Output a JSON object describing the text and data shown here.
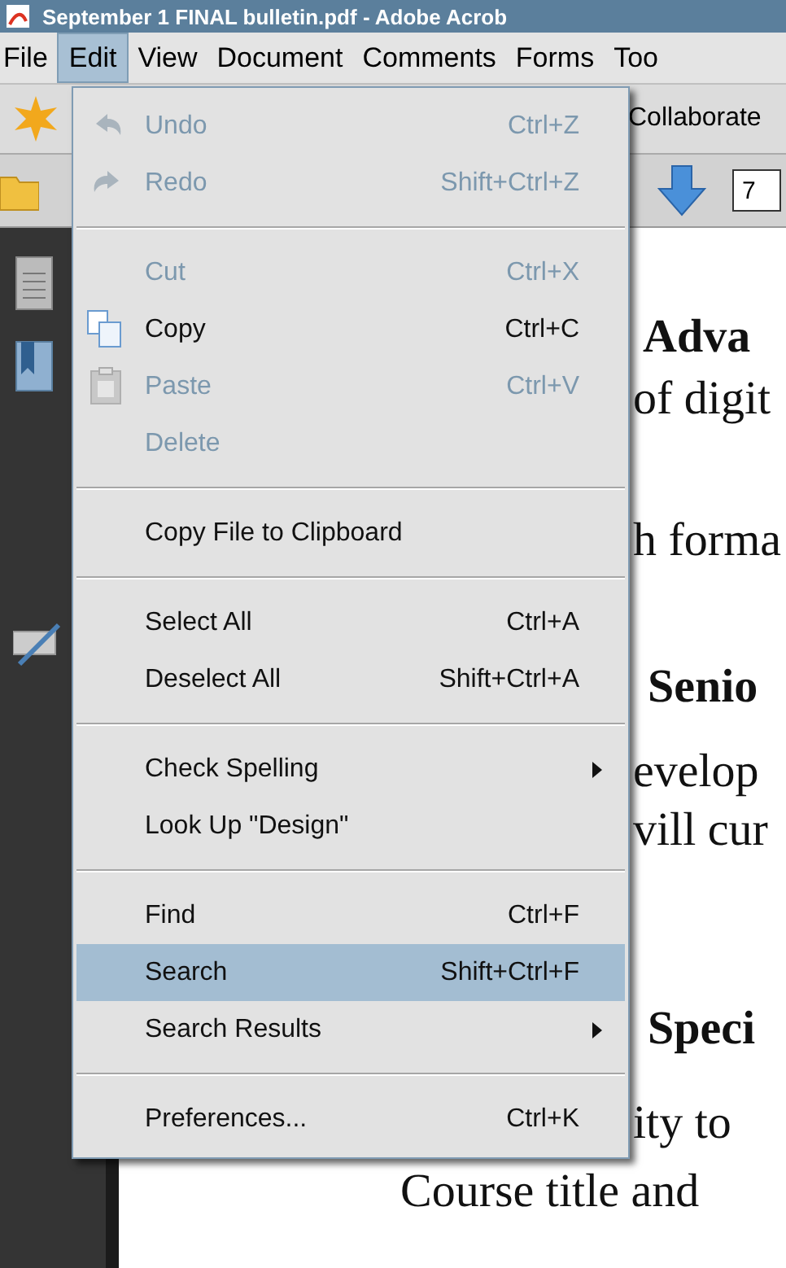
{
  "window": {
    "title": "September 1 FINAL bulletin.pdf - Adobe Acrob"
  },
  "menubar": [
    {
      "label": "File",
      "selected": false
    },
    {
      "label": "Edit",
      "selected": true
    },
    {
      "label": "View",
      "selected": false
    },
    {
      "label": "Document",
      "selected": false
    },
    {
      "label": "Comments",
      "selected": false
    },
    {
      "label": "Forms",
      "selected": false
    },
    {
      "label": "Too",
      "selected": false
    }
  ],
  "toolbar": {
    "collaborate": "Collaborate",
    "page_field": "7"
  },
  "edit_menu": [
    {
      "kind": "item",
      "label": "Undo",
      "shortcut": "Ctrl+Z",
      "disabled": true,
      "selected": false,
      "submenu": false
    },
    {
      "kind": "item",
      "label": "Redo",
      "shortcut": "Shift+Ctrl+Z",
      "disabled": true,
      "selected": false,
      "submenu": false
    },
    {
      "kind": "separator"
    },
    {
      "kind": "item",
      "label": "Cut",
      "shortcut": "Ctrl+X",
      "disabled": true,
      "selected": false,
      "submenu": false
    },
    {
      "kind": "item",
      "label": "Copy",
      "shortcut": "Ctrl+C",
      "disabled": false,
      "selected": false,
      "submenu": false
    },
    {
      "kind": "item",
      "label": "Paste",
      "shortcut": "Ctrl+V",
      "disabled": true,
      "selected": false,
      "submenu": false
    },
    {
      "kind": "item",
      "label": "Delete",
      "disabled": true,
      "selected": false,
      "submenu": false
    },
    {
      "kind": "separator"
    },
    {
      "kind": "item",
      "label": "Copy File to Clipboard",
      "disabled": false,
      "selected": false,
      "submenu": false
    },
    {
      "kind": "separator"
    },
    {
      "kind": "item",
      "label": "Select All",
      "shortcut": "Ctrl+A",
      "disabled": false,
      "selected": false,
      "submenu": false
    },
    {
      "kind": "item",
      "label": "Deselect All",
      "shortcut": "Shift+Ctrl+A",
      "disabled": false,
      "selected": false,
      "submenu": false
    },
    {
      "kind": "separator"
    },
    {
      "kind": "item",
      "label": "Check Spelling",
      "disabled": false,
      "selected": false,
      "submenu": true
    },
    {
      "kind": "item",
      "label": "Look Up \"Design\"",
      "disabled": false,
      "selected": false,
      "submenu": false
    },
    {
      "kind": "separator"
    },
    {
      "kind": "item",
      "label": "Find",
      "shortcut": "Ctrl+F",
      "disabled": false,
      "selected": false,
      "submenu": false
    },
    {
      "kind": "item",
      "label": "Search",
      "shortcut": "Shift+Ctrl+F",
      "disabled": false,
      "selected": true,
      "submenu": false
    },
    {
      "kind": "item",
      "label": "Search Results",
      "disabled": false,
      "selected": false,
      "submenu": true
    },
    {
      "kind": "separator"
    },
    {
      "kind": "item",
      "label": "Preferences...",
      "shortcut": "Ctrl+K",
      "disabled": false,
      "selected": false,
      "submenu": false
    }
  ],
  "document_lines": [
    {
      "kind": "heading",
      "text": "Adva"
    },
    {
      "kind": "body",
      "text": "of digit"
    },
    {
      "kind": "body",
      "text": "h forma"
    },
    {
      "kind": "heading",
      "text": "Senio"
    },
    {
      "kind": "body",
      "text": "evelop"
    },
    {
      "kind": "body",
      "text": "vill cur"
    },
    {
      "kind": "heading",
      "text": "Speci"
    },
    {
      "kind": "body",
      "text": "ity to"
    },
    {
      "kind": "body",
      "text": "Course title and"
    }
  ]
}
